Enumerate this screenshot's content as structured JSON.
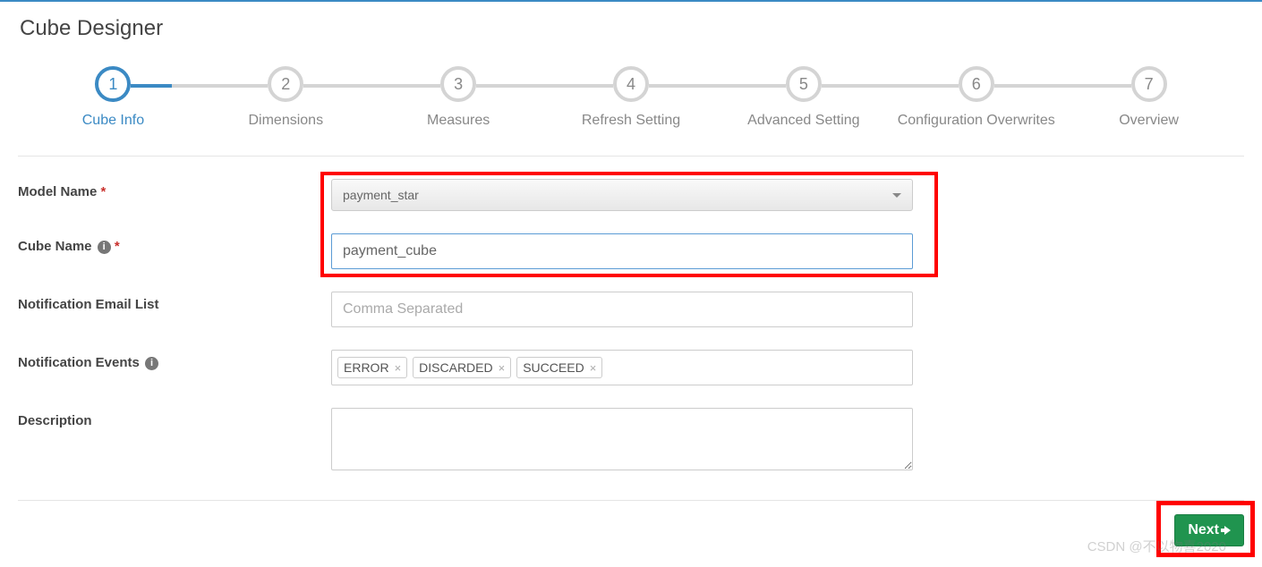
{
  "page": {
    "title": "Cube Designer"
  },
  "stepper": {
    "active_index": 0,
    "steps": [
      {
        "num": "1",
        "label": "Cube Info"
      },
      {
        "num": "2",
        "label": "Dimensions"
      },
      {
        "num": "3",
        "label": "Measures"
      },
      {
        "num": "4",
        "label": "Refresh Setting"
      },
      {
        "num": "5",
        "label": "Advanced Setting"
      },
      {
        "num": "6",
        "label": "Configuration Overwrites"
      },
      {
        "num": "7",
        "label": "Overview"
      }
    ]
  },
  "form": {
    "model_name": {
      "label": "Model Name",
      "required": "*",
      "value": "payment_star"
    },
    "cube_name": {
      "label": "Cube Name",
      "required": "*",
      "value": "payment_cube"
    },
    "email_list": {
      "label": "Notification Email List",
      "placeholder": "Comma Separated",
      "value": ""
    },
    "events": {
      "label": "Notification Events",
      "tags": [
        "ERROR",
        "DISCARDED",
        "SUCCEED"
      ]
    },
    "description": {
      "label": "Description",
      "value": ""
    }
  },
  "footer": {
    "next_label": "Next"
  },
  "watermark": "CSDN @不以物喜2020"
}
